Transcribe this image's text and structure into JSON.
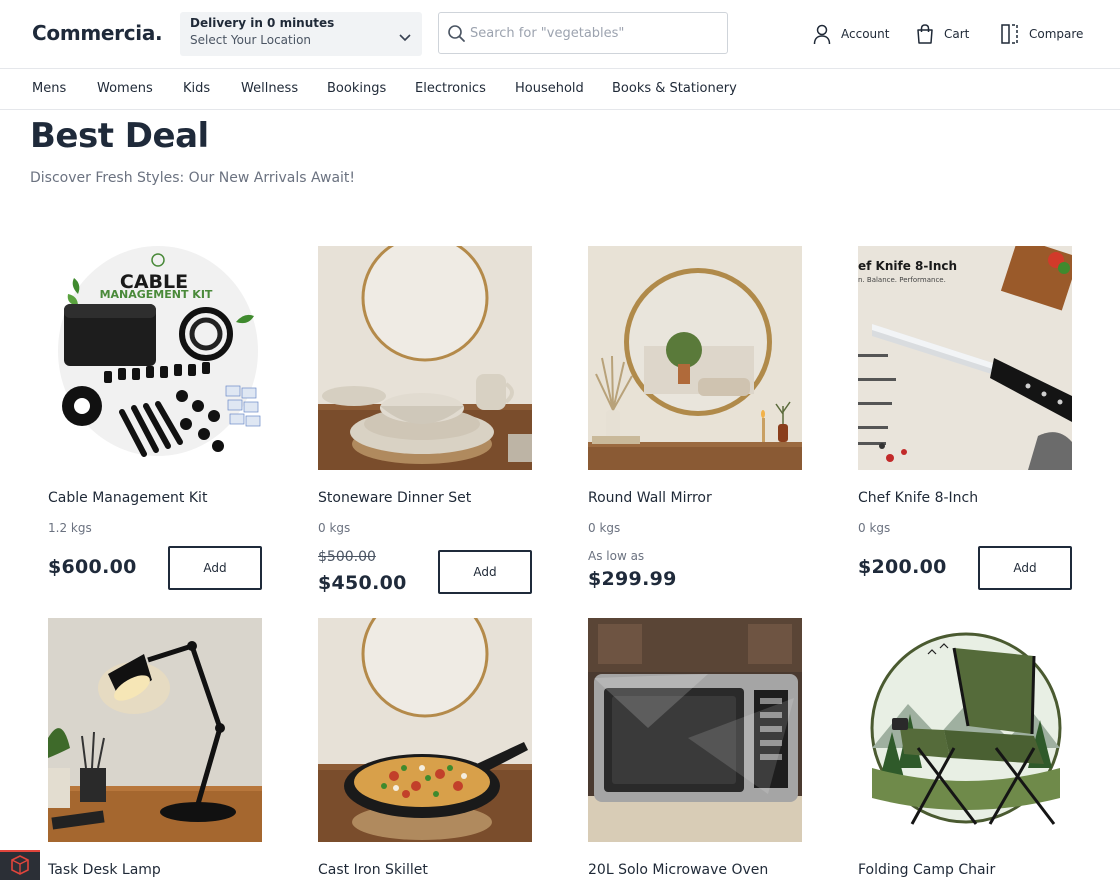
{
  "header": {
    "logo": "Commercia.",
    "delivery_title": "Delivery in 0 minutes",
    "delivery_location": "Select Your Location",
    "search_placeholder": "Search for \"vegetables\"",
    "account_label": "Account",
    "cart_label": "Cart",
    "compare_label": "Compare"
  },
  "categories": [
    "Mens",
    "Womens",
    "Kids",
    "Wellness",
    "Bookings",
    "Electronics",
    "Household",
    "Books & Stationery"
  ],
  "section": {
    "title": "Best Deal",
    "subtitle": "Discover Fresh Styles: Our New Arrivals Await!"
  },
  "products": [
    {
      "name": "Cable Management Kit",
      "weight": "1.2 kgs",
      "price": "$600.00",
      "add_label": "Add",
      "image_text": [
        "CABLE",
        "MANAGEMENT KIT"
      ]
    },
    {
      "name": "Stoneware Dinner Set",
      "weight": "0 kgs",
      "old_price": "$500.00",
      "price": "$450.00",
      "add_label": "Add"
    },
    {
      "name": "Round Wall Mirror",
      "weight": "0 kgs",
      "price_prefix": "As low as",
      "price": "$299.99"
    },
    {
      "name": "Chef Knife 8-Inch",
      "weight": "0 kgs",
      "price": "$200.00",
      "add_label": "Add",
      "image_text": [
        "ef Knife 8-Inch",
        "n. Balance. Performance."
      ]
    },
    {
      "name": "Task Desk Lamp"
    },
    {
      "name": "Cast Iron Skillet"
    },
    {
      "name": "20L Solo Microwave Oven"
    },
    {
      "name": "Folding Camp Chair"
    }
  ],
  "colors": {
    "text_dark": "#1f2a3a",
    "muted": "#6b7280",
    "border": "#e5e7eb",
    "delivery_bg": "#f1f3f5"
  }
}
